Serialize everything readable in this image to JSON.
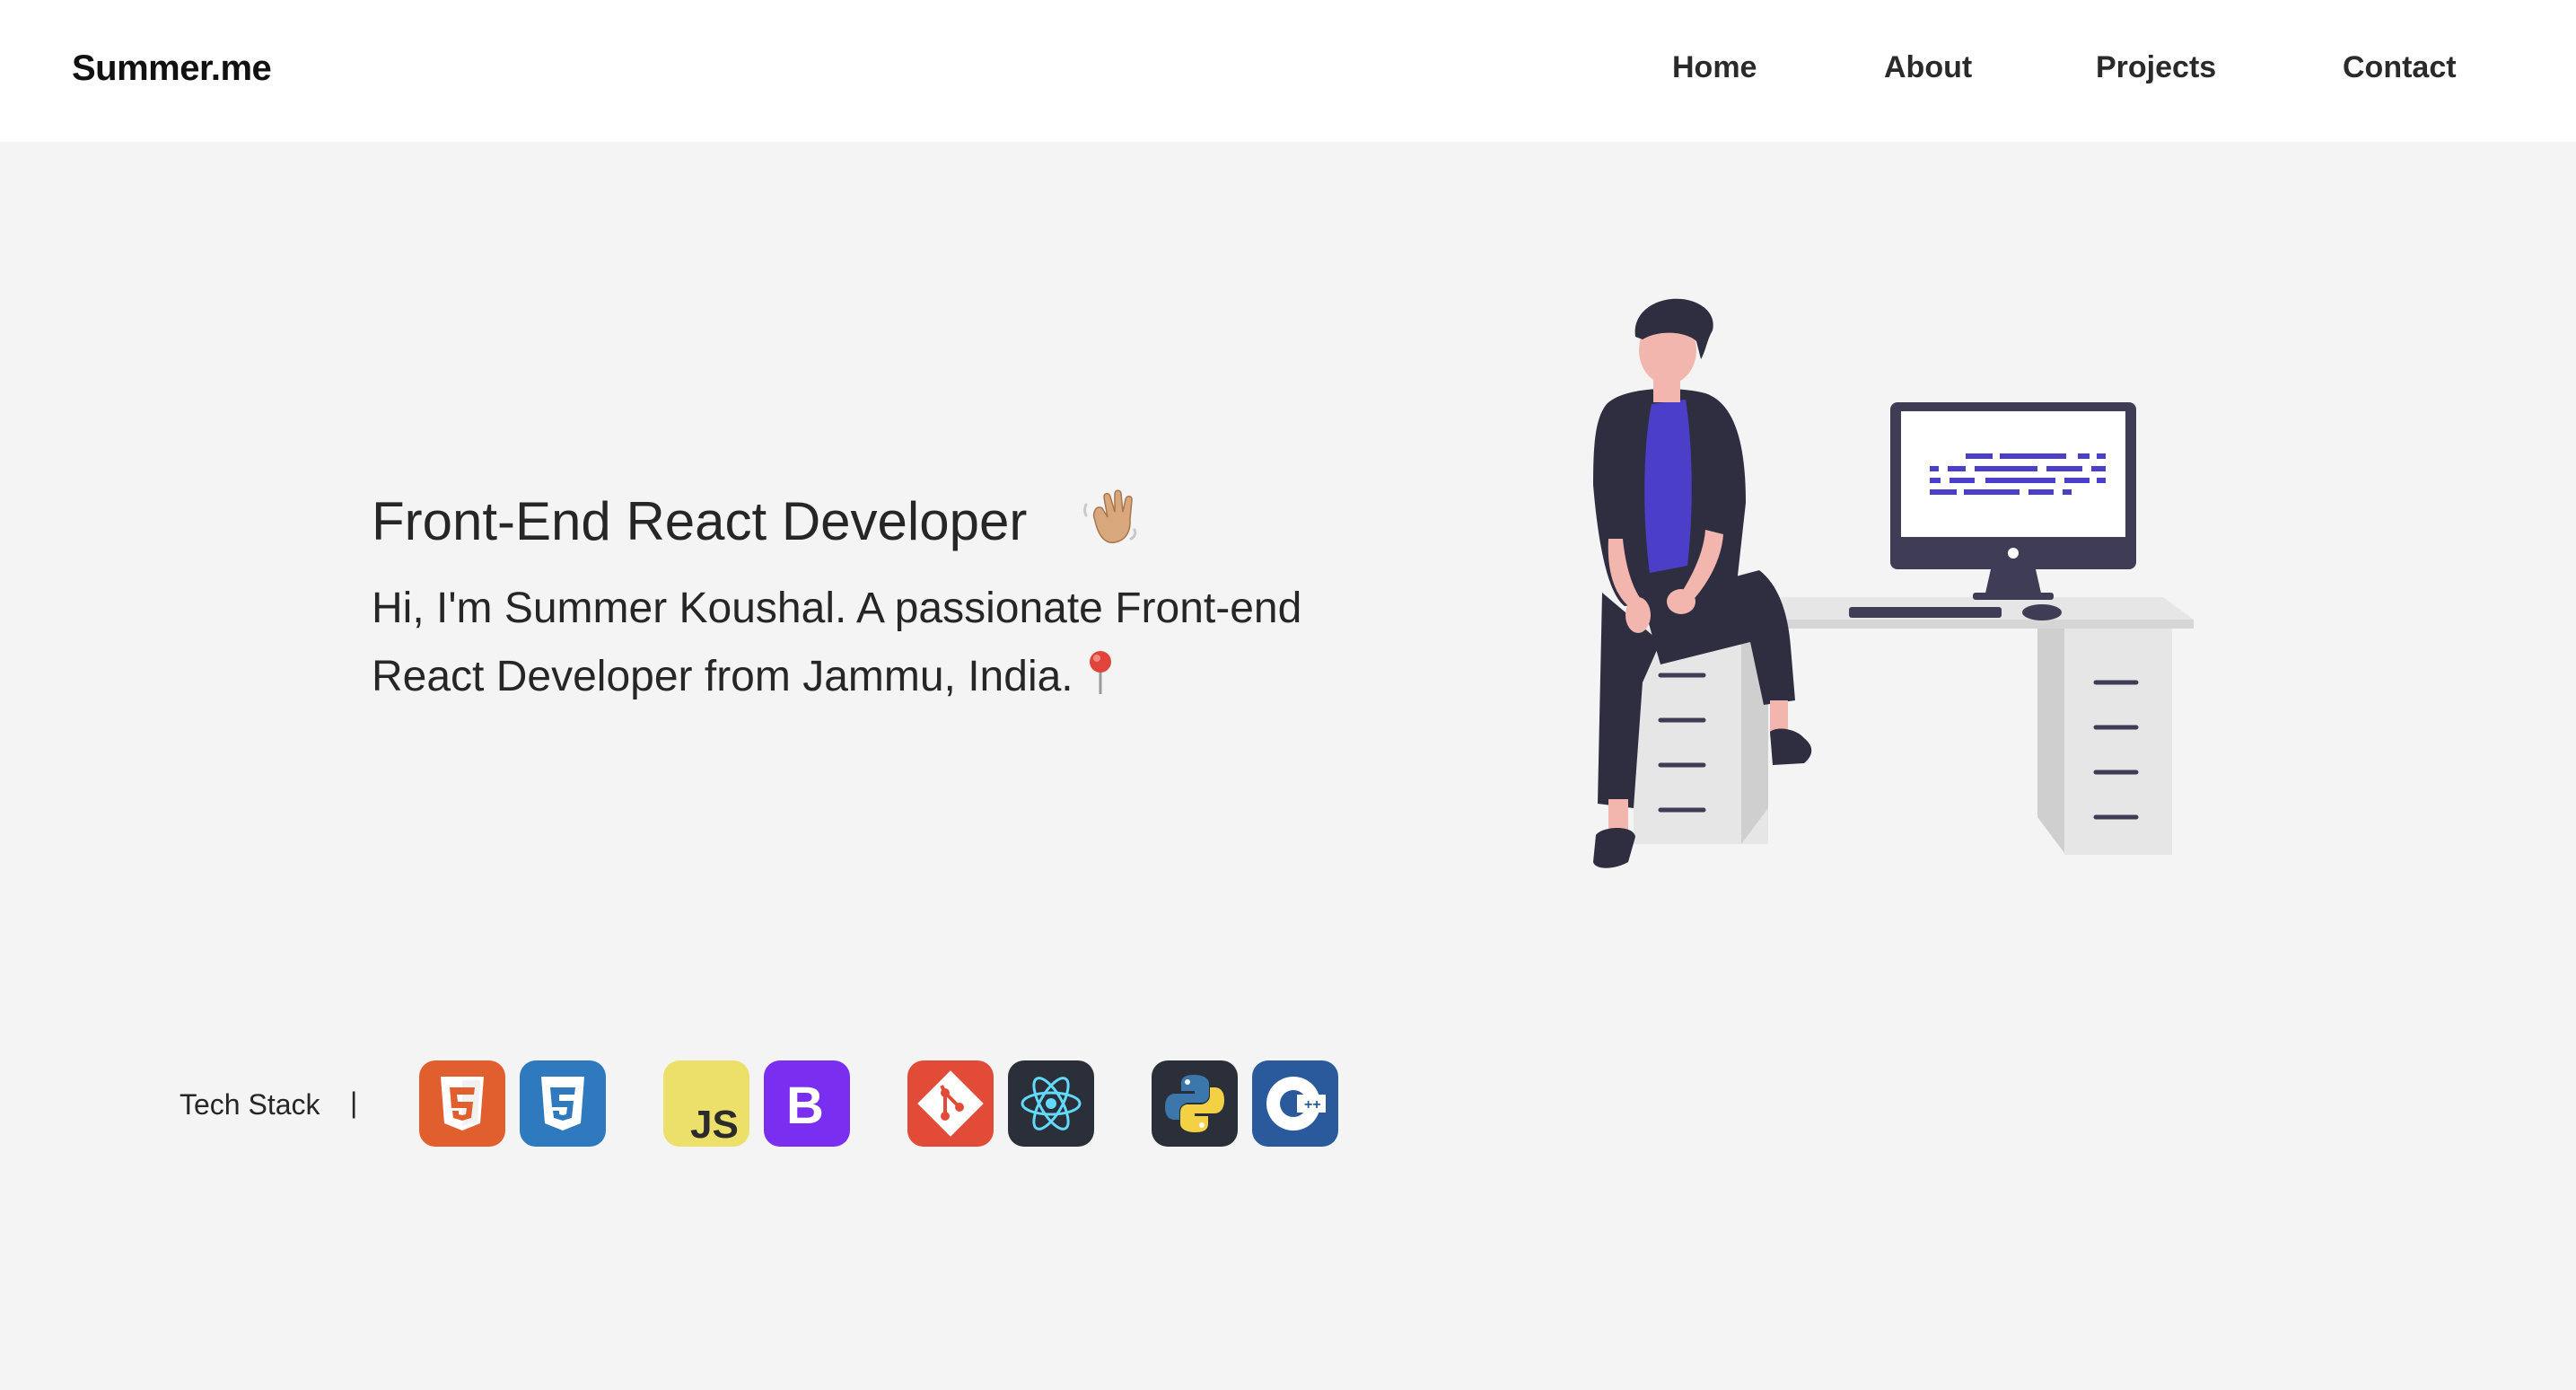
{
  "navbar": {
    "brand": "Summer.me",
    "links": [
      "Home",
      "About",
      "Projects",
      "Contact"
    ]
  },
  "hero": {
    "title": "Front-End React Developer",
    "description": "Hi, I'm Summer Koushal. A passionate Front-end React Developer from Jammu, India.",
    "title_icon": "waving-hand-icon",
    "description_icon": "round-pushpin-icon"
  },
  "tech_stack": {
    "label": "Tech Stack",
    "separator": "|",
    "icons": [
      "html5-icon",
      "css3-icon",
      "javascript-icon",
      "bootstrap-icon",
      "git-icon",
      "react-icon",
      "python-icon",
      "cplusplus-icon"
    ]
  },
  "colors": {
    "background": "#f4f4f4",
    "navbar": "#ffffff",
    "accent_purple": "#4b3fc9"
  }
}
